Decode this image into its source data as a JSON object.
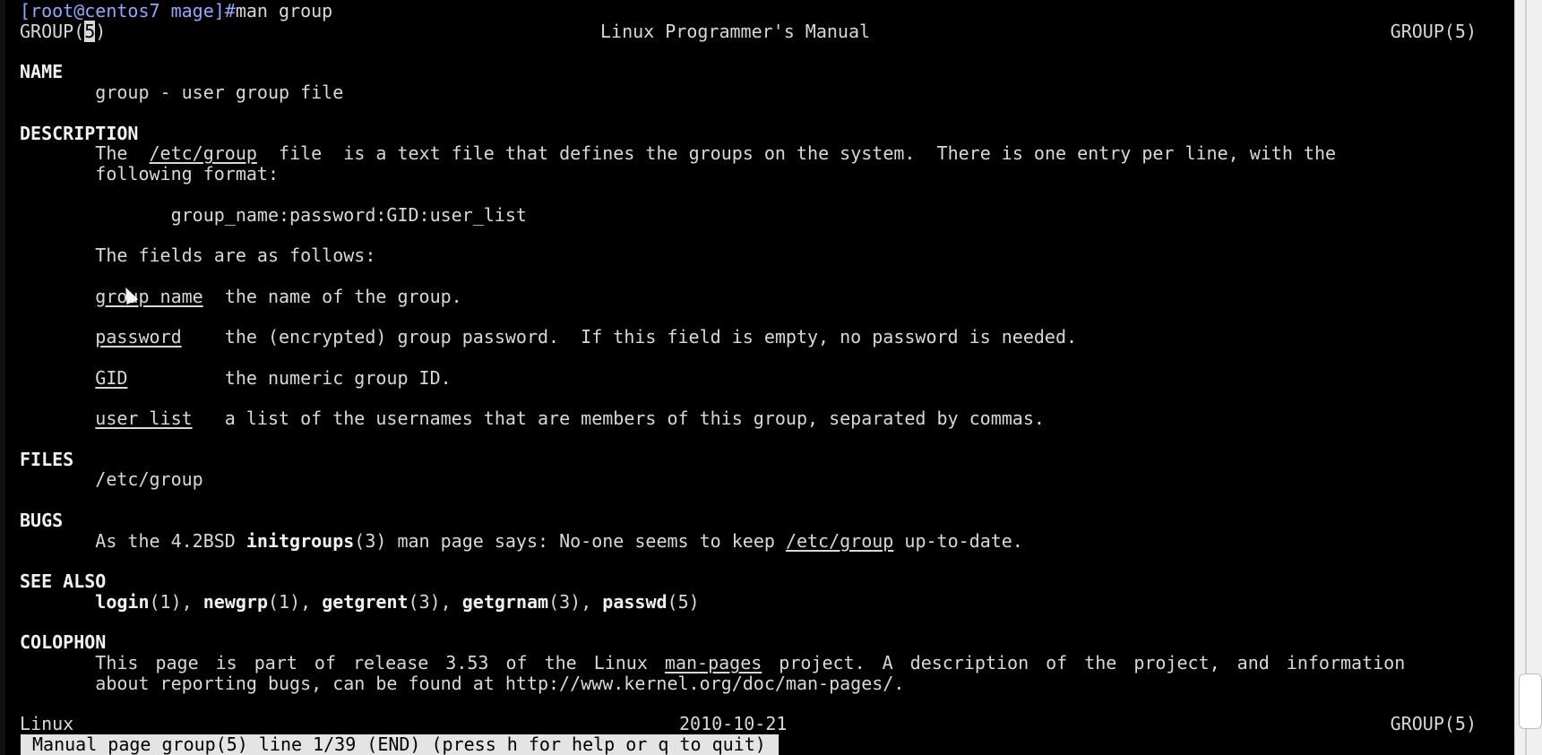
{
  "prompt": {
    "user_host": "[root@centos7 mage]#",
    "command": "man group"
  },
  "header": {
    "left_pre": "GROUP(",
    "left_cursor": "5",
    "left_post": ")",
    "center": "Linux Programmer's Manual",
    "right": "GROUP(5)"
  },
  "sections": {
    "name_heading": "NAME",
    "name_text": "group - user group file",
    "description_heading": "DESCRIPTION",
    "desc_the": "The",
    "desc_file_path": "/etc/group",
    "desc_rest_line1": "file  is a text file that defines the groups on the system.  There is one entry per line, with the",
    "desc_line2": "following format:",
    "format_line": "group_name:password:GID:user_list",
    "fields_intro": "The fields are as follows:",
    "fields": [
      {
        "name": "group_name",
        "desc": "the name of the group."
      },
      {
        "name": "password",
        "desc": "the (encrypted) group password.  If this field is empty, no password is needed."
      },
      {
        "name": "GID",
        "desc": "the numeric group ID."
      },
      {
        "name": "user_list",
        "desc": "a list of the usernames that are members of this group, separated by commas."
      }
    ],
    "files_heading": "FILES",
    "files_text": "/etc/group",
    "bugs_heading": "BUGS",
    "bugs_pre": "As the 4.2BSD ",
    "bugs_func": "initgroups",
    "bugs_mid": "(3) man page says: No-one seems to keep ",
    "bugs_path": "/etc/group",
    "bugs_post": " up-to-date.",
    "see_also_heading": "SEE ALSO",
    "see_also": [
      {
        "name": "login",
        "sect": "(1)",
        "sep": ", "
      },
      {
        "name": "newgrp",
        "sect": "(1)",
        "sep": ", "
      },
      {
        "name": "getgrent",
        "sect": "(3)",
        "sep": ", "
      },
      {
        "name": "getgrnam",
        "sect": "(3)",
        "sep": ", "
      },
      {
        "name": "passwd",
        "sect": "(5)",
        "sep": ""
      }
    ],
    "colophon_heading": "COLOPHON",
    "colophon_words": [
      "This",
      "page",
      "is",
      "part",
      "of",
      "release",
      "3.53",
      "of",
      "the",
      "Linux",
      "man-pages",
      "project.",
      "A",
      "description",
      "of",
      "the",
      "project,",
      "and",
      "information"
    ],
    "colophon_line2": "about reporting bugs, can be found at http://www.kernel.org/doc/man-pages/."
  },
  "footer": {
    "left": "Linux",
    "center": "2010-10-21",
    "right": "GROUP(5)"
  },
  "status_bar": "Manual page group(5) line 1/39 (END) (press h for help or q to quit)"
}
